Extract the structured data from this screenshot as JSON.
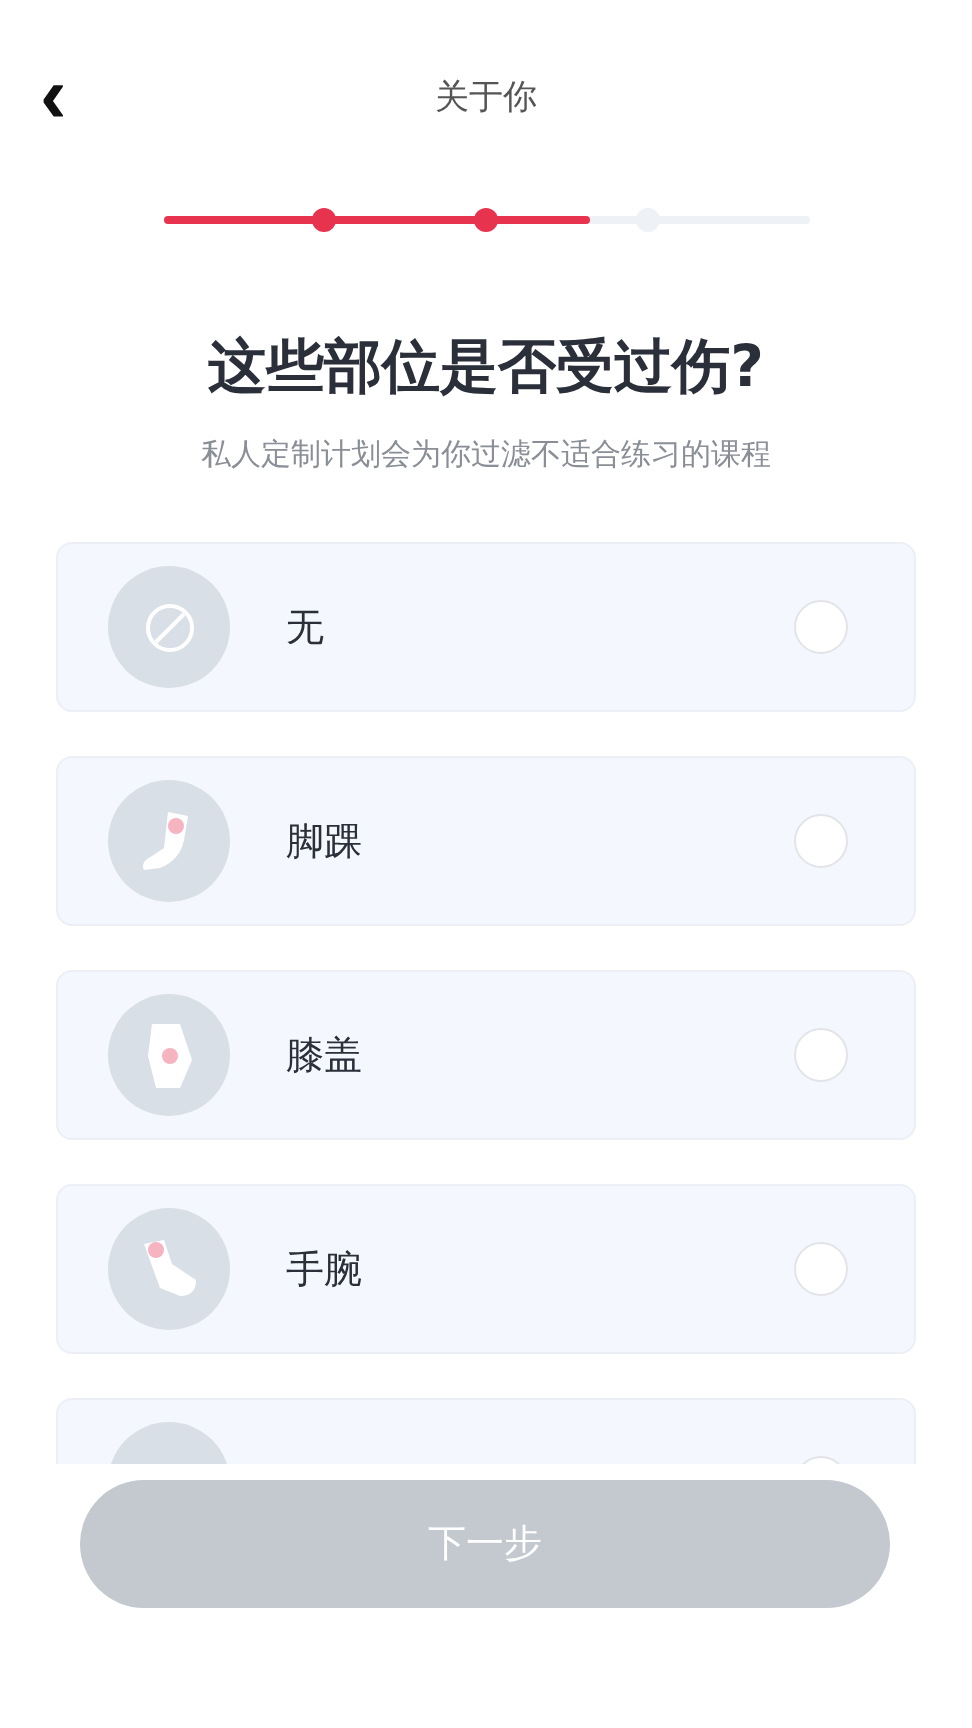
{
  "header": {
    "back": "‹",
    "title": "关于你"
  },
  "progress": {
    "level": 0.66,
    "steps": [
      {
        "done": true
      },
      {
        "done": true
      },
      {
        "done": false
      }
    ]
  },
  "heading": "这些部位是否受过伤?",
  "subtitle": "私人定制计划会为你过滤不适合练习的课程",
  "options": [
    {
      "kind": "none",
      "label": "无",
      "selected": false
    },
    {
      "kind": "ankle",
      "label": "脚踝",
      "selected": false
    },
    {
      "kind": "knee",
      "label": "膝盖",
      "selected": false
    },
    {
      "kind": "wrist",
      "label": "手腕",
      "selected": false
    },
    {
      "kind": "partial",
      "selected": false
    }
  ],
  "next_button": {
    "label": "下一步",
    "disabled": true
  }
}
